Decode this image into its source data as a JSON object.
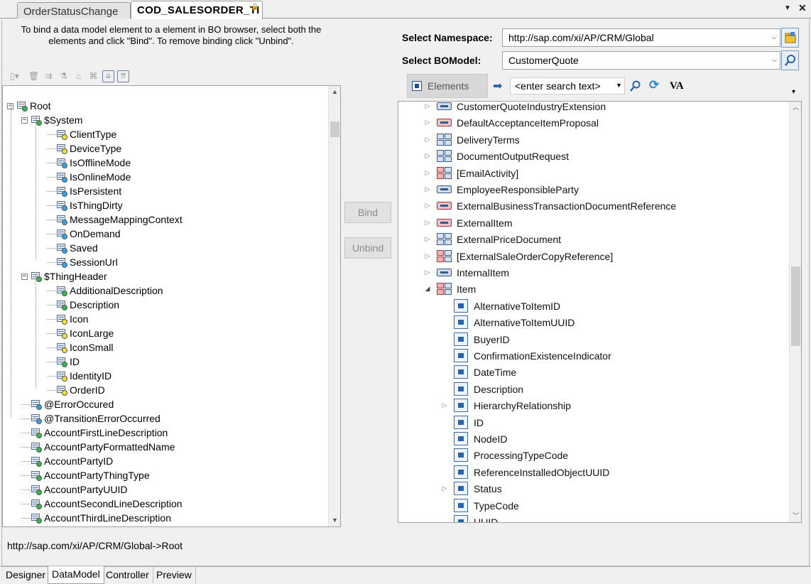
{
  "doc_tabs": {
    "inactive": "OrderStatusChange",
    "active": "COD_SALESORDER_TI",
    "lock": "🔒",
    "dropdown": "▼",
    "close": "✕"
  },
  "instructions": "To bind a data model element to a element in BO browser, select both the elements and click \"Bind\". To remove binding click \"Unbind\".",
  "data_tree": {
    "rows": [
      {
        "label": "Root",
        "indent": 0,
        "expander": "−",
        "kind": "folder"
      },
      {
        "label": "$System",
        "indent": 1,
        "expander": "−",
        "kind": "folder"
      },
      {
        "label": "ClientType",
        "indent": 2,
        "dot": "yellow"
      },
      {
        "label": "DeviceType",
        "indent": 2,
        "dot": "yellow"
      },
      {
        "label": "IsOfflineMode",
        "indent": 2,
        "dot": "blue"
      },
      {
        "label": "IsOnlineMode",
        "indent": 2,
        "dot": "blue"
      },
      {
        "label": "IsPersistent",
        "indent": 2,
        "dot": "blue"
      },
      {
        "label": "IsThingDirty",
        "indent": 2,
        "dot": "blue"
      },
      {
        "label": "MessageMappingContext",
        "indent": 2,
        "dot": "blue"
      },
      {
        "label": "OnDemand",
        "indent": 2,
        "dot": "blue"
      },
      {
        "label": "Saved",
        "indent": 2,
        "dot": "blue"
      },
      {
        "label": "SessionUrl",
        "indent": 2,
        "dot": "blue"
      },
      {
        "label": "$ThingHeader",
        "indent": 1,
        "expander": "−",
        "kind": "folder"
      },
      {
        "label": "AdditionalDescription",
        "indent": 2,
        "dot": "green"
      },
      {
        "label": "Description",
        "indent": 2,
        "dot": "green"
      },
      {
        "label": "Icon",
        "indent": 2,
        "dot": "yellow"
      },
      {
        "label": "IconLarge",
        "indent": 2,
        "dot": "yellow"
      },
      {
        "label": "IconSmall",
        "indent": 2,
        "dot": "yellow"
      },
      {
        "label": "ID",
        "indent": 2,
        "dot": "green"
      },
      {
        "label": "IdentityID",
        "indent": 2,
        "dot": "yellow"
      },
      {
        "label": "OrderID",
        "indent": 2,
        "dot": "yellow"
      },
      {
        "label": "@ErrorOccured",
        "indent": 1,
        "dot": "blue"
      },
      {
        "label": "@TransitionErrorOccurred",
        "indent": 1,
        "dot": "blue"
      },
      {
        "label": "AccountFirstLineDescription",
        "indent": 1,
        "dot": "green"
      },
      {
        "label": "AccountPartyFormattedName",
        "indent": 1,
        "dot": "green"
      },
      {
        "label": "AccountPartyID",
        "indent": 1,
        "dot": "green"
      },
      {
        "label": "AccountPartyThingType",
        "indent": 1,
        "dot": "green"
      },
      {
        "label": "AccountPartyUUID",
        "indent": 1,
        "dot": "green"
      },
      {
        "label": "AccountSecondLineDescription",
        "indent": 1,
        "dot": "green"
      },
      {
        "label": "AccountThirdLineDescription",
        "indent": 1,
        "dot": "green"
      }
    ]
  },
  "buttons": {
    "bind": "Bind",
    "unbind": "Unbind"
  },
  "namespace": {
    "label": "Select Namespace:",
    "value": "http://sap.com/xi/AP/CRM/Global"
  },
  "bomodel": {
    "label": "Select BOModel:",
    "value": "CustomerQuote"
  },
  "bo_toolbar": {
    "elements_label": "Elements",
    "search_placeholder": "<enter search text>",
    "va_label": "VA"
  },
  "bo_tree": {
    "rows": [
      {
        "label": "CustomerQuoteIndustryExtension",
        "level": 0,
        "arrow": "▷",
        "icon": "wide"
      },
      {
        "label": "DefaultAcceptanceItemProposal",
        "level": 0,
        "arrow": "▷",
        "icon": "wide-red"
      },
      {
        "label": "DeliveryTerms",
        "level": 0,
        "arrow": "▷",
        "icon": "grid"
      },
      {
        "label": "DocumentOutputRequest",
        "level": 0,
        "arrow": "▷",
        "icon": "grid"
      },
      {
        "label": "[EmailActivity]",
        "level": 0,
        "arrow": "▷",
        "icon": "grid-red"
      },
      {
        "label": "EmployeeResponsibleParty",
        "level": 0,
        "arrow": "▷",
        "icon": "wide"
      },
      {
        "label": "ExternalBusinessTransactionDocumentReference",
        "level": 0,
        "arrow": "▷",
        "icon": "wide-red"
      },
      {
        "label": "ExternalItem",
        "level": 0,
        "arrow": "▷",
        "icon": "wide-red"
      },
      {
        "label": "ExternalPriceDocument",
        "level": 0,
        "arrow": "▷",
        "icon": "grid"
      },
      {
        "label": "[ExternalSaleOrderCopyReference]",
        "level": 0,
        "arrow": "▷",
        "icon": "grid-red"
      },
      {
        "label": "InternalItem",
        "level": 0,
        "arrow": "▷",
        "icon": "wide"
      },
      {
        "label": "Item",
        "level": 0,
        "arrow": "◢",
        "icon": "grid-red"
      },
      {
        "label": "AlternativeToItemID",
        "level": 1,
        "arrow": "",
        "icon": "attr"
      },
      {
        "label": "AlternativeToItemUUID",
        "level": 1,
        "arrow": "",
        "icon": "attr"
      },
      {
        "label": "BuyerID",
        "level": 1,
        "arrow": "",
        "icon": "attr"
      },
      {
        "label": "ConfirmationExistenceIndicator",
        "level": 1,
        "arrow": "",
        "icon": "attr"
      },
      {
        "label": "DateTime",
        "level": 1,
        "arrow": "",
        "icon": "attr"
      },
      {
        "label": "Description",
        "level": 1,
        "arrow": "",
        "icon": "attr"
      },
      {
        "label": "HierarchyRelationship",
        "level": 1,
        "arrow": "▷",
        "icon": "attr"
      },
      {
        "label": "ID",
        "level": 1,
        "arrow": "",
        "icon": "attr"
      },
      {
        "label": "NodeID",
        "level": 1,
        "arrow": "",
        "icon": "attr"
      },
      {
        "label": "ProcessingTypeCode",
        "level": 1,
        "arrow": "",
        "icon": "attr"
      },
      {
        "label": "ReferenceInstalledObjectUUID",
        "level": 1,
        "arrow": "",
        "icon": "attr"
      },
      {
        "label": "Status",
        "level": 1,
        "arrow": "▷",
        "icon": "attr"
      },
      {
        "label": "TypeCode",
        "level": 1,
        "arrow": "",
        "icon": "attr"
      },
      {
        "label": "UUID",
        "level": 1,
        "arrow": "",
        "icon": "attr"
      }
    ]
  },
  "status_path": "http://sap.com/xi/AP/CRM/Global->Root",
  "bottom_tabs": [
    {
      "label": "Designer"
    },
    {
      "label": "DataModel"
    },
    {
      "label": "Controller"
    },
    {
      "label": "Preview"
    }
  ],
  "colors": {
    "yellow_dot": "#f2e23c",
    "blue_dot": "#3aa0e0",
    "green_dot": "#39b54a",
    "accent": "#1f4e8c"
  }
}
